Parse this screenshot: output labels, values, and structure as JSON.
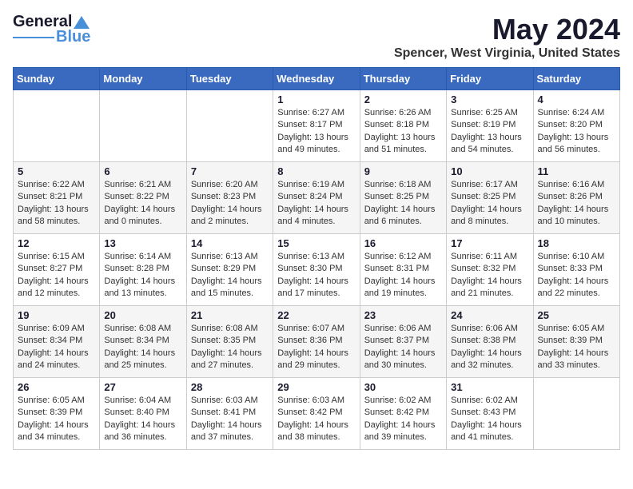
{
  "logo": {
    "line1": "General",
    "line2": "Blue"
  },
  "title": "May 2024",
  "location": "Spencer, West Virginia, United States",
  "days_header": [
    "Sunday",
    "Monday",
    "Tuesday",
    "Wednesday",
    "Thursday",
    "Friday",
    "Saturday"
  ],
  "weeks": [
    [
      {
        "day": "",
        "info": ""
      },
      {
        "day": "",
        "info": ""
      },
      {
        "day": "",
        "info": ""
      },
      {
        "day": "1",
        "info": "Sunrise: 6:27 AM\nSunset: 8:17 PM\nDaylight: 13 hours and 49 minutes."
      },
      {
        "day": "2",
        "info": "Sunrise: 6:26 AM\nSunset: 8:18 PM\nDaylight: 13 hours and 51 minutes."
      },
      {
        "day": "3",
        "info": "Sunrise: 6:25 AM\nSunset: 8:19 PM\nDaylight: 13 hours and 54 minutes."
      },
      {
        "day": "4",
        "info": "Sunrise: 6:24 AM\nSunset: 8:20 PM\nDaylight: 13 hours and 56 minutes."
      }
    ],
    [
      {
        "day": "5",
        "info": "Sunrise: 6:22 AM\nSunset: 8:21 PM\nDaylight: 13 hours and 58 minutes."
      },
      {
        "day": "6",
        "info": "Sunrise: 6:21 AM\nSunset: 8:22 PM\nDaylight: 14 hours and 0 minutes."
      },
      {
        "day": "7",
        "info": "Sunrise: 6:20 AM\nSunset: 8:23 PM\nDaylight: 14 hours and 2 minutes."
      },
      {
        "day": "8",
        "info": "Sunrise: 6:19 AM\nSunset: 8:24 PM\nDaylight: 14 hours and 4 minutes."
      },
      {
        "day": "9",
        "info": "Sunrise: 6:18 AM\nSunset: 8:25 PM\nDaylight: 14 hours and 6 minutes."
      },
      {
        "day": "10",
        "info": "Sunrise: 6:17 AM\nSunset: 8:25 PM\nDaylight: 14 hours and 8 minutes."
      },
      {
        "day": "11",
        "info": "Sunrise: 6:16 AM\nSunset: 8:26 PM\nDaylight: 14 hours and 10 minutes."
      }
    ],
    [
      {
        "day": "12",
        "info": "Sunrise: 6:15 AM\nSunset: 8:27 PM\nDaylight: 14 hours and 12 minutes."
      },
      {
        "day": "13",
        "info": "Sunrise: 6:14 AM\nSunset: 8:28 PM\nDaylight: 14 hours and 13 minutes."
      },
      {
        "day": "14",
        "info": "Sunrise: 6:13 AM\nSunset: 8:29 PM\nDaylight: 14 hours and 15 minutes."
      },
      {
        "day": "15",
        "info": "Sunrise: 6:13 AM\nSunset: 8:30 PM\nDaylight: 14 hours and 17 minutes."
      },
      {
        "day": "16",
        "info": "Sunrise: 6:12 AM\nSunset: 8:31 PM\nDaylight: 14 hours and 19 minutes."
      },
      {
        "day": "17",
        "info": "Sunrise: 6:11 AM\nSunset: 8:32 PM\nDaylight: 14 hours and 21 minutes."
      },
      {
        "day": "18",
        "info": "Sunrise: 6:10 AM\nSunset: 8:33 PM\nDaylight: 14 hours and 22 minutes."
      }
    ],
    [
      {
        "day": "19",
        "info": "Sunrise: 6:09 AM\nSunset: 8:34 PM\nDaylight: 14 hours and 24 minutes."
      },
      {
        "day": "20",
        "info": "Sunrise: 6:08 AM\nSunset: 8:34 PM\nDaylight: 14 hours and 25 minutes."
      },
      {
        "day": "21",
        "info": "Sunrise: 6:08 AM\nSunset: 8:35 PM\nDaylight: 14 hours and 27 minutes."
      },
      {
        "day": "22",
        "info": "Sunrise: 6:07 AM\nSunset: 8:36 PM\nDaylight: 14 hours and 29 minutes."
      },
      {
        "day": "23",
        "info": "Sunrise: 6:06 AM\nSunset: 8:37 PM\nDaylight: 14 hours and 30 minutes."
      },
      {
        "day": "24",
        "info": "Sunrise: 6:06 AM\nSunset: 8:38 PM\nDaylight: 14 hours and 32 minutes."
      },
      {
        "day": "25",
        "info": "Sunrise: 6:05 AM\nSunset: 8:39 PM\nDaylight: 14 hours and 33 minutes."
      }
    ],
    [
      {
        "day": "26",
        "info": "Sunrise: 6:05 AM\nSunset: 8:39 PM\nDaylight: 14 hours and 34 minutes."
      },
      {
        "day": "27",
        "info": "Sunrise: 6:04 AM\nSunset: 8:40 PM\nDaylight: 14 hours and 36 minutes."
      },
      {
        "day": "28",
        "info": "Sunrise: 6:03 AM\nSunset: 8:41 PM\nDaylight: 14 hours and 37 minutes."
      },
      {
        "day": "29",
        "info": "Sunrise: 6:03 AM\nSunset: 8:42 PM\nDaylight: 14 hours and 38 minutes."
      },
      {
        "day": "30",
        "info": "Sunrise: 6:02 AM\nSunset: 8:42 PM\nDaylight: 14 hours and 39 minutes."
      },
      {
        "day": "31",
        "info": "Sunrise: 6:02 AM\nSunset: 8:43 PM\nDaylight: 14 hours and 41 minutes."
      },
      {
        "day": "",
        "info": ""
      }
    ]
  ]
}
